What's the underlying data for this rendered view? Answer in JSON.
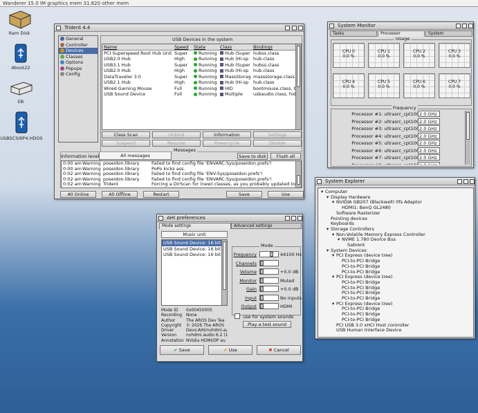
{
  "menubar": {
    "title": "Wanderer 15.0 IM graphics mem 31.820 other mem"
  },
  "desktop": {
    "icons": [
      {
        "label": "Ram Disk",
        "icon": "ram-disk-icon"
      },
      {
        "label": "Aboot22",
        "icon": "usb-drive-icon"
      },
      {
        "label": "EB",
        "icon": "hard-disk-icon"
      },
      {
        "label": "USBSCSI9P4.HDOS",
        "icon": "usb-drive-icon"
      }
    ]
  },
  "trident": {
    "title": "Trident 4.4",
    "nav": [
      "General",
      "Controller",
      "Devices",
      "Classes",
      "Options",
      "Popups",
      "Config"
    ],
    "selected_nav": "Devices",
    "devices_title": "USB Devices in the system",
    "columns": [
      "Name",
      "Speed",
      "State",
      "Class",
      "Bindings"
    ],
    "rows": [
      [
        "PCI Superspeed Root Hub Unit 0",
        "Super",
        "Running",
        "Hub (Super",
        "hubss.class"
      ],
      [
        "USB2.0 Hub",
        "High",
        "Running",
        "Hub (Hi-sp",
        "hub.class"
      ],
      [
        "USB3.1 Hub",
        "Super",
        "Running",
        "Hub (Super",
        "hubss.class"
      ],
      [
        "USB2.0 Hub",
        "High",
        "Running",
        "Hub (Hi-sp",
        "hub.class"
      ],
      [
        "DataTraveler 3.0",
        "Super",
        "Running",
        "MassStorag",
        "massstorage.class"
      ],
      [
        "USB2.1 Hub",
        "High",
        "Running",
        "Hub (Hi-sp",
        "hub.class"
      ],
      [
        "Wired Gaming Mouse",
        "Full",
        "Running",
        "HID",
        "bootmouse.class, bo"
      ],
      [
        "USB Sound Device",
        "Full",
        "Running",
        "Multiple",
        "usbaudio.class, hid"
      ]
    ],
    "buttons": [
      "Class Scan",
      "Unbind",
      "Information",
      "Settings",
      "Suspend",
      "Resume",
      "Powercycle",
      "Disable"
    ],
    "info_label": "Information level:",
    "info_value": "All messages",
    "save_to_disk": "Save to disk",
    "flush_all": "Flush all",
    "messages_label": "Messages",
    "log": [
      [
        "0:00 am",
        "Warning",
        "poseidon.library",
        "Failed to find config file 'ENVARC:Sys/poseidon.prefs'!"
      ],
      [
        "0:00 am",
        "Warning",
        "poseidon.library",
        "PoPo kicks ass."
      ],
      [
        "0:02 am",
        "Warning",
        "poseidon.library",
        "Failed to find config file 'ENV:Sys/poseidon.prefs'!"
      ],
      [
        "0:02 am",
        "Warning",
        "poseidon.library",
        "Failed to find config file 'ENVARC:Sys/poseidon.prefs'!"
      ],
      [
        "0:02 am",
        "Warning",
        "Trident",
        "Forcing a DirScan for (new) classes, as you probably updated to a n"
      ]
    ],
    "bottom_buttons": [
      "All Online",
      "All Offline",
      "Restart",
      "Save",
      "Use"
    ]
  },
  "sysmon": {
    "title": "System Monitor",
    "tabs": [
      "Tasks",
      "Processor",
      "System"
    ],
    "active_tab": "Processor",
    "usage_label": "Usage",
    "cpus": [
      {
        "name": "CPU 0",
        "value": "0.0 %"
      },
      {
        "name": "CPU 1",
        "value": "0.0 %"
      },
      {
        "name": "CPU 2",
        "value": "0.0 %"
      },
      {
        "name": "CPU 3",
        "value": "0.0 %"
      },
      {
        "name": "CPU 4",
        "value": "0.0 %"
      },
      {
        "name": "CPU 5",
        "value": "0.0 %"
      },
      {
        "name": "CPU 6",
        "value": "0.0 %"
      },
      {
        "name": "CPU 7",
        "value": "0.0 %"
      }
    ],
    "freq_label": "Frequency",
    "processors": [
      {
        "label": "Processor #1: ultrasrc_cpt100",
        "freq": "2.0 GHz"
      },
      {
        "label": "Processor #2: ultrasrc_cpt100",
        "freq": "2.0 GHz"
      },
      {
        "label": "Processor #3: ultrasrc_cpt100",
        "freq": "2.0 GHz"
      },
      {
        "label": "Processor #4: ultrasrc_cpt100",
        "freq": "2.0 GHz"
      },
      {
        "label": "Processor #5: ultrasrc_cpt100",
        "freq": "2.0 GHz"
      },
      {
        "label": "Processor #6: ultrasrc_cpt100",
        "freq": "2.0 GHz"
      },
      {
        "label": "Processor #7: ultrasrc_cpt100",
        "freq": "2.0 GHz"
      },
      {
        "label": "Processor #8: ultrasrc_cpt100",
        "freq": "2.0 GHz"
      }
    ]
  },
  "explorer": {
    "title": "System Explorer",
    "tree": [
      {
        "t": "Computer",
        "d": 0,
        "x": true
      },
      {
        "t": "Display Hardware",
        "d": 1,
        "x": true
      },
      {
        "t": "NVIDIA GB207 (Blackwell) 0fs Adaptor",
        "d": 2,
        "x": true
      },
      {
        "t": "HDMI1: BenQ GL2480",
        "d": 3,
        "x": false
      },
      {
        "t": "Software Rasterizer",
        "d": 2,
        "x": false
      },
      {
        "t": "Pointing devices",
        "d": 1,
        "x": false
      },
      {
        "t": "Keyboards",
        "d": 1,
        "x": false
      },
      {
        "t": "Storage Controllers",
        "d": 1,
        "x": true
      },
      {
        "t": "Non-Volatile Memory Express Controller",
        "d": 2,
        "x": true
      },
      {
        "t": "NVME 1.780 Device Bus",
        "d": 3,
        "x": true
      },
      {
        "t": "Sabrent",
        "d": 4,
        "x": false
      },
      {
        "t": "System Devices",
        "d": 1,
        "x": true
      },
      {
        "t": "PCI Express (device tree)",
        "d": 2,
        "x": true
      },
      {
        "t": "PCI-to-PCI Bridge",
        "d": 3,
        "x": false
      },
      {
        "t": "PCI-to-PCI Bridge",
        "d": 3,
        "x": false
      },
      {
        "t": "PCI-to-PCI Bridge",
        "d": 3,
        "x": false
      },
      {
        "t": "PCI Express (device tree)",
        "d": 2,
        "x": true
      },
      {
        "t": "PCI-to-PCI Bridge",
        "d": 3,
        "x": false
      },
      {
        "t": "PCI-to-PCI Bridge",
        "d": 3,
        "x": false
      },
      {
        "t": "PCI-to-PCI Bridge",
        "d": 3,
        "x": false
      },
      {
        "t": "PCI-to-PCI Bridge",
        "d": 3,
        "x": false
      },
      {
        "t": "PCI Express (device tree)",
        "d": 2,
        "x": true
      },
      {
        "t": "PCI-to-PCI Bridge",
        "d": 3,
        "x": false
      },
      {
        "t": "PCI-to-PCI Bridge",
        "d": 3,
        "x": false
      },
      {
        "t": "PCI-to-PCI Bridge",
        "d": 3,
        "x": false
      },
      {
        "t": "PCI USB 3.0 xHCI Host controller",
        "d": 2,
        "x": false
      },
      {
        "t": "USB Human Interface Device",
        "d": 2,
        "x": false
      }
    ]
  },
  "ahi": {
    "title": "AHI preferences",
    "mode_settings": "Mode settings",
    "adv_settings": "Advanced settings",
    "unit": "Music unit",
    "modes": [
      "USB Sound Device: 16 bit stereo++",
      "USB Sound Device: 16 bit st",
      "USB Sound Device: 16 bit st"
    ],
    "info_keys": [
      "Mode ID",
      "Recording",
      "Author",
      "Copyright",
      "Driver",
      "Version",
      "Annotation"
    ],
    "info_vals": [
      "0x00450005",
      "None",
      "The AROS Dev Tea",
      "© 2026 The AROS",
      "Devs:AHI/nvhdmi.au",
      "nvhdmi.audio 6.2 (1",
      "NVidia HDMI/DP au"
    ],
    "params_label": "Mode",
    "params": [
      {
        "k": "Frequency",
        "v": "44100 Hz"
      },
      {
        "k": "Channels",
        "v": ""
      },
      {
        "k": "Volume",
        "v": "+0.0 dB"
      },
      {
        "k": "Monitor",
        "v": "Muted"
      },
      {
        "k": "Gain",
        "v": "+0.0 dB"
      },
      {
        "k": "Input",
        "v": "No inputs"
      },
      {
        "k": "Output",
        "v": "HDMI"
      }
    ],
    "system_sounds": "use for system sounds",
    "play_test": "Play a test sound",
    "save": "Save",
    "use": "Use",
    "cancel": "Cancel"
  }
}
